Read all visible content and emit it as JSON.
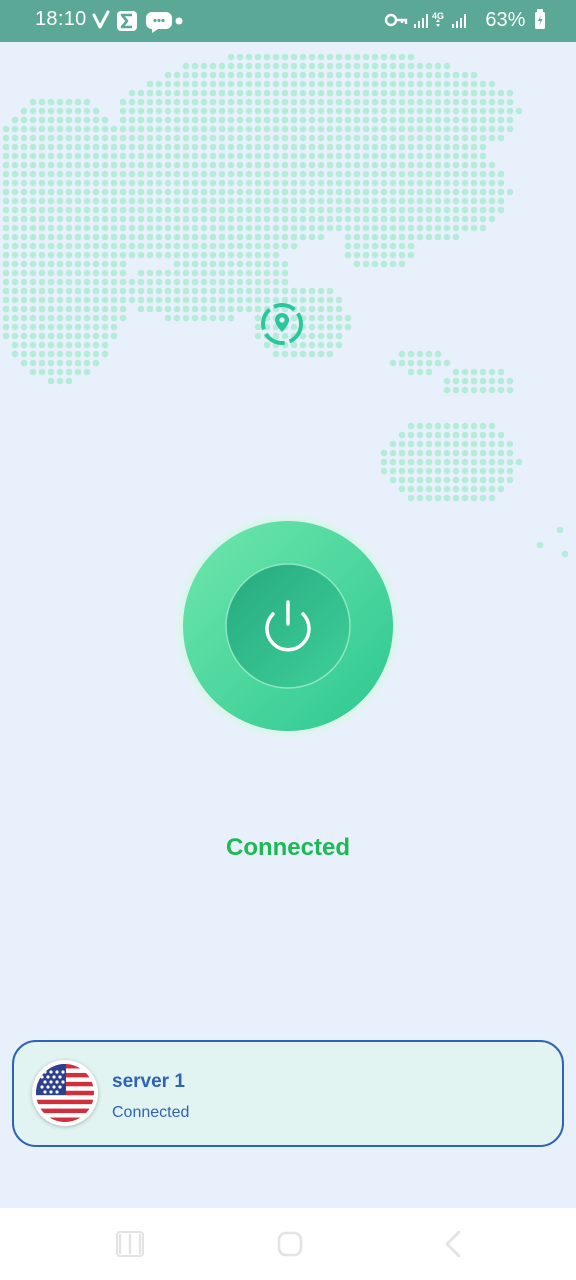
{
  "status_bar": {
    "time": "18:10",
    "battery_percent": "63%",
    "network_label": "4G",
    "icons": [
      "vpn-check-icon",
      "sigma-app-icon",
      "chat-bubble-icon",
      "notification-dot-icon",
      "vpn-key-icon",
      "signal-bars-icon",
      "signal-4g-bars-icon",
      "battery-icon"
    ]
  },
  "map": {
    "dot_color": "#b4ecd9",
    "marker_color": "#2bc79a"
  },
  "power_button": {
    "icon": "power-icon",
    "state": "on",
    "colors": {
      "outer": "#4fdca4",
      "inner": "#2bb98e",
      "glow": "#c9f2e2"
    }
  },
  "connection": {
    "status_text": "Connected",
    "color": "#1db954"
  },
  "server": {
    "name": "server 1",
    "status": "Connected",
    "flag": "united-states-flag",
    "border_color": "#2f63b8"
  },
  "nav_bar": {
    "buttons": [
      "recent-apps-icon",
      "home-icon",
      "back-icon"
    ]
  }
}
